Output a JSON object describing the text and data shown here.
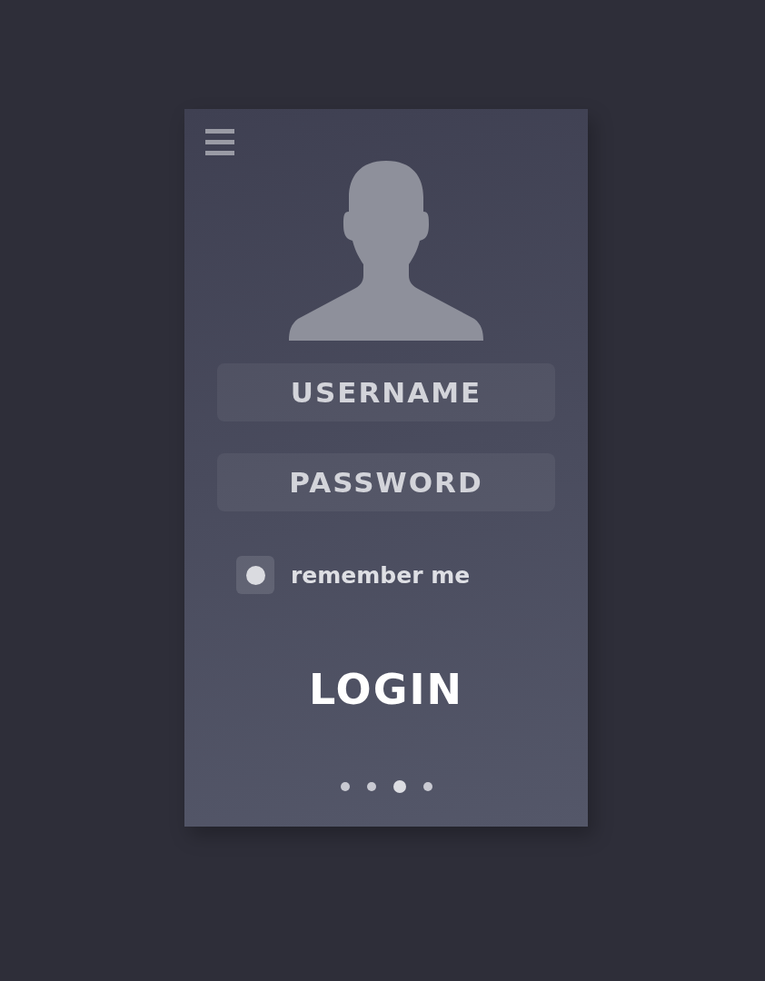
{
  "fields": [
    {
      "placeholder": "USERNAME"
    },
    {
      "placeholder": "PASSWORD"
    }
  ],
  "remember": {
    "label": "remember me",
    "checked": true
  },
  "login": {
    "label": "LOGIN"
  },
  "pager": [
    {
      "selected": false
    },
    {
      "selected": false
    },
    {
      "selected": true
    },
    {
      "selected": false
    }
  ]
}
